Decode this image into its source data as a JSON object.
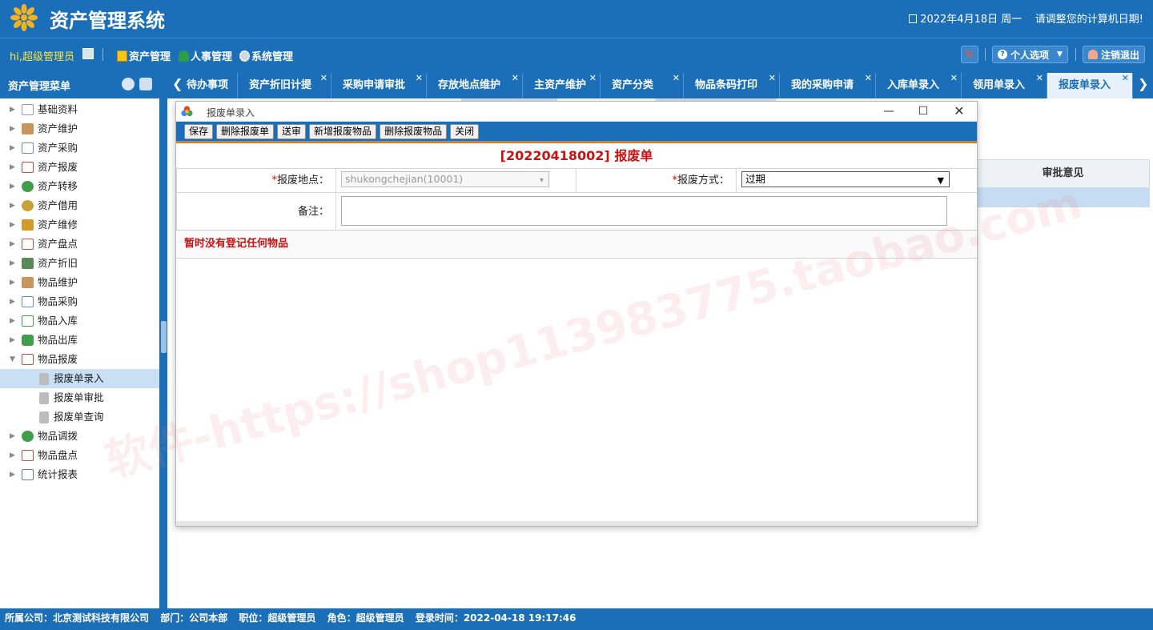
{
  "header": {
    "app_title": "资产管理系统",
    "date_text": "2022年4月18日 周一",
    "date_notice": "请调整您的计算机日期!"
  },
  "toolbar": {
    "greeting": "hi,超级管理员",
    "menus": [
      {
        "label": "资产管理",
        "icon": "folder-icon"
      },
      {
        "label": "人事管理",
        "icon": "people-icon"
      },
      {
        "label": "系统管理",
        "icon": "gear-icon"
      }
    ],
    "personal_options": "个人选项",
    "logout": "注销退出"
  },
  "sidebar": {
    "title": "资产管理菜单",
    "nodes": [
      {
        "label": "基础资料",
        "icon": "grid-icon",
        "color": "#8a9bb3"
      },
      {
        "label": "资产维护",
        "icon": "box-icon",
        "color": "#c8955a"
      },
      {
        "label": "资产采购",
        "icon": "cart-icon",
        "color": "#6d8fb5"
      },
      {
        "label": "资产报废",
        "icon": "cart-remove-icon",
        "color": "#c64a3c"
      },
      {
        "label": "资产转移",
        "icon": "transfer-icon",
        "color": "#3f9e4a"
      },
      {
        "label": "资产借用",
        "icon": "borrow-icon",
        "color": "#c7a13a"
      },
      {
        "label": "资产维修",
        "icon": "repair-icon",
        "color": "#d39a27"
      },
      {
        "label": "资产盘点",
        "icon": "inventory-icon",
        "color": "#c0503f"
      },
      {
        "label": "资产折旧",
        "icon": "calculator-icon",
        "color": "#5a8a5a"
      },
      {
        "label": "物品维护",
        "icon": "package-icon",
        "color": "#c8955a"
      },
      {
        "label": "物品采购",
        "icon": "cart-icon",
        "color": "#6d8fb5"
      },
      {
        "label": "物品入库",
        "icon": "import-icon",
        "color": "#3f9e4a"
      },
      {
        "label": "物品出库",
        "icon": "export-icon",
        "color": "#3f9e4a"
      },
      {
        "label": "物品报废",
        "icon": "cart-remove-icon",
        "color": "#c64a3c"
      }
    ],
    "children": [
      {
        "label": "报废单录入"
      },
      {
        "label": "报废单审批"
      },
      {
        "label": "报废单查询"
      }
    ],
    "tail_nodes": [
      {
        "label": "物品调拨",
        "icon": "transfer-icon",
        "color": "#3f9e4a"
      },
      {
        "label": "物品盘点",
        "icon": "inventory-icon",
        "color": "#c0503f"
      },
      {
        "label": "统计报表",
        "icon": "chart-icon",
        "color": "#5a7fae"
      }
    ]
  },
  "tabs": [
    {
      "label": "待办事项"
    },
    {
      "label": "资产折旧计提"
    },
    {
      "label": "采购申请审批"
    },
    {
      "label": "存放地点维护"
    },
    {
      "label": "主资产维护"
    },
    {
      "label": "资产分类"
    },
    {
      "label": "物品条码打印"
    },
    {
      "label": "我的采购申请"
    },
    {
      "label": "入库单录入"
    },
    {
      "label": "领用单录入"
    },
    {
      "label": "报废单录入"
    }
  ],
  "background": {
    "column_header": "审批意见"
  },
  "dialog": {
    "title": "报废单录入",
    "buttons": [
      "保存",
      "删除报废单",
      "送审",
      "新增报废物品",
      "删除报废物品",
      "关闭"
    ],
    "form_title": "[20220418002] 报废单",
    "location_label": "报废地点：",
    "location_value": "shukongchejian(10001)",
    "method_label": "报废方式：",
    "method_value": "过期",
    "remark_label": "备注：",
    "empty_message": "暂时没有登记任何物品"
  },
  "statusbar": {
    "company": "所属公司：北京测试科技有限公司",
    "department": "部门：公司本部",
    "position": "职位：超级管理员",
    "role": "角色：超级管理员",
    "login_time": "登录时间：2022-04-18 19:17:46"
  },
  "watermark": "软件-https://shop113983775.taobao.com",
  "colors": {
    "primary": "#1b6fb8",
    "accent_red": "#cc1111",
    "greeting_yellow": "#ffe23a"
  }
}
